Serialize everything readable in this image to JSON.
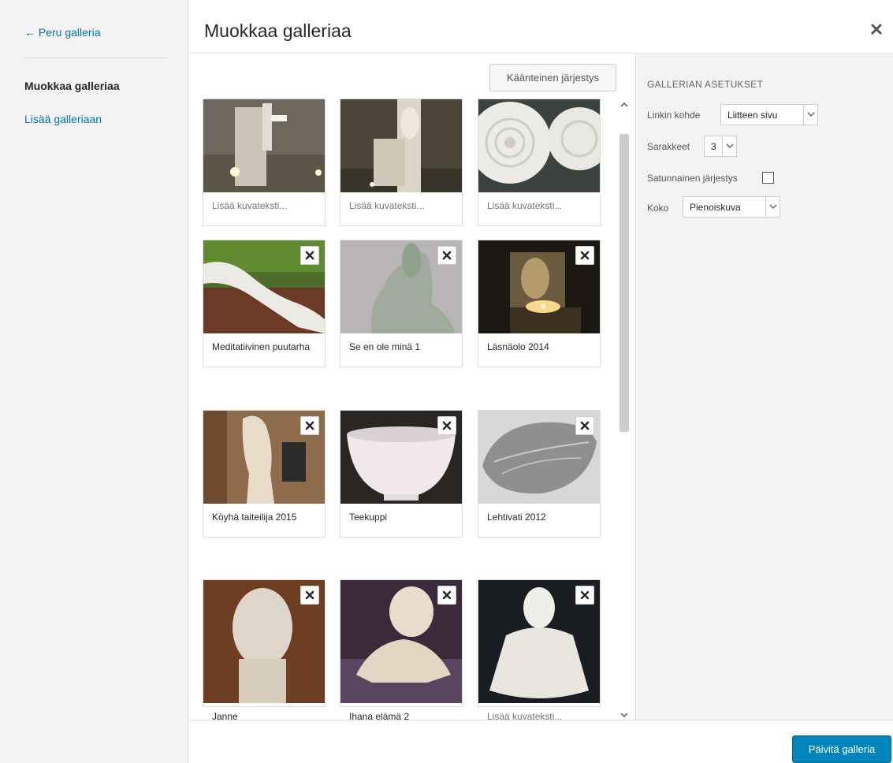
{
  "sidebar": {
    "cancel_label": "← Peru galleria",
    "items": [
      {
        "label": "Muokkaa galleriaa"
      },
      {
        "label": "Lisää galleriaan"
      }
    ]
  },
  "header": {
    "title": "Muokkaa galleriaa"
  },
  "toolbar": {
    "reverse_label": "Käänteinen järjestys"
  },
  "gallery": {
    "tiles": [
      {
        "caption": "Lisää kuvateksti..."
      },
      {
        "caption": "Lisää kuvateksti..."
      },
      {
        "caption": "Lisää kuvateksti..."
      },
      {
        "caption": "Meditatiivinen puutarha"
      },
      {
        "caption": "Se en ole minä 1"
      },
      {
        "caption": "Läsnäolo 2014"
      },
      {
        "caption": "Köyhä taiteilija 2015"
      },
      {
        "caption": "Teekuppi"
      },
      {
        "caption": "Lehtivati 2012"
      },
      {
        "caption": "Janne"
      },
      {
        "caption": "Ihana elämä 2"
      },
      {
        "caption": "Lisää kuvateksti..."
      }
    ]
  },
  "settings": {
    "heading": "GALLERIAN ASETUKSET",
    "link_label": "Linkin kohde",
    "link_value": "Liitteen sivu",
    "columns_label": "Sarakkeet",
    "columns_value": "3",
    "random_label": "Satunnainen järjestys",
    "size_label": "Koko",
    "size_value": "Pienoiskuva"
  },
  "footer": {
    "update_label": "Päivitä galleria"
  },
  "colors": {
    "link": "#0073aa",
    "primary": "#0085ba"
  }
}
